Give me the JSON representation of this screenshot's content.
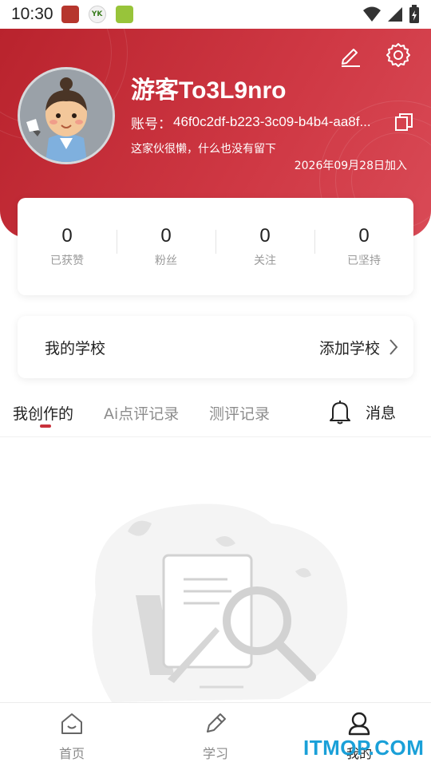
{
  "status_bar": {
    "time": "10:30",
    "app_icons": [
      "red-app-icon",
      "yk-app-icon",
      "green-app-icon"
    ],
    "app_icon_texts": [
      "",
      "YK",
      ""
    ],
    "right_icons": [
      "wifi-icon",
      "signal-icon",
      "battery-icon"
    ]
  },
  "header": {
    "username": "游客To3L9nro",
    "account_label": "账号：",
    "account_id": "46f0c2df-b223-3c09-b4b4-aa8f...",
    "bio": "这家伙很懒，什么也没有留下",
    "join_date": "2026年09月28日加入",
    "icons": [
      "edit-icon",
      "settings-icon",
      "copy-icon"
    ],
    "accent_color": "#c8303a"
  },
  "stats": [
    {
      "value": "0",
      "label": "已获赞"
    },
    {
      "value": "0",
      "label": "粉丝"
    },
    {
      "value": "0",
      "label": "关注"
    },
    {
      "value": "0",
      "label": "已坚持"
    }
  ],
  "school": {
    "title": "我的学校",
    "action": "添加学校"
  },
  "tabs": [
    {
      "label": "我创作的",
      "active": true
    },
    {
      "label": "Ai点评记录",
      "active": false
    },
    {
      "label": "测评记录",
      "active": false
    }
  ],
  "messages": {
    "label": "消息"
  },
  "bottom_nav": [
    {
      "label": "首页",
      "icon": "home-icon",
      "active": false
    },
    {
      "label": "学习",
      "icon": "pencil-icon",
      "active": false
    },
    {
      "label": "我的",
      "icon": "profile-icon",
      "active": true
    }
  ],
  "watermark": "ITMOP.COM"
}
